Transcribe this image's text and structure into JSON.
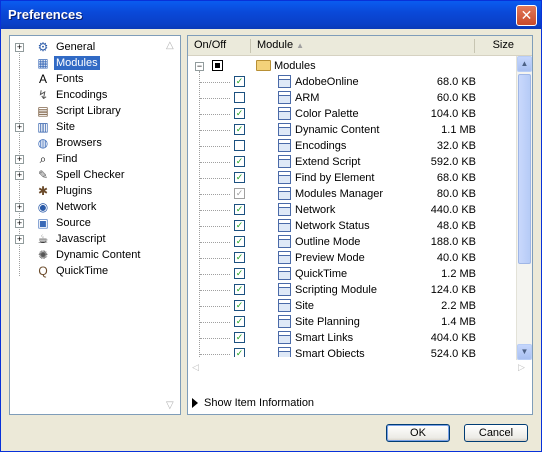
{
  "window": {
    "title": "Preferences",
    "close_glyph": "✕"
  },
  "sidebar": {
    "items": [
      {
        "label": "General",
        "icon": "gear-icon",
        "glyph": "⚙",
        "expander": "+"
      },
      {
        "label": "Modules",
        "icon": "module-icon",
        "glyph": "▦",
        "selected": true
      },
      {
        "label": "Fonts",
        "icon": "fonts-icon",
        "glyph": "A"
      },
      {
        "label": "Encodings",
        "icon": "encodings-icon",
        "glyph": "↯"
      },
      {
        "label": "Script Library",
        "icon": "script-library-icon",
        "glyph": "▤"
      },
      {
        "label": "Site",
        "icon": "site-icon",
        "glyph": "▥",
        "expander": "+"
      },
      {
        "label": "Browsers",
        "icon": "browsers-icon",
        "glyph": "◍"
      },
      {
        "label": "Find",
        "icon": "find-icon",
        "glyph": "⌕",
        "expander": "+"
      },
      {
        "label": "Spell Checker",
        "icon": "spell-checker-icon",
        "glyph": "✎",
        "expander": "+"
      },
      {
        "label": "Plugins",
        "icon": "plugins-icon",
        "glyph": "✱"
      },
      {
        "label": "Network",
        "icon": "network-icon",
        "glyph": "◉",
        "expander": "+"
      },
      {
        "label": "Source",
        "icon": "source-icon",
        "glyph": "▣",
        "expander": "+"
      },
      {
        "label": "Javascript",
        "icon": "javascript-icon",
        "glyph": "☕",
        "expander": "+"
      },
      {
        "label": "Dynamic Content",
        "icon": "dynamic-content-icon",
        "glyph": "✺"
      },
      {
        "label": "QuickTime",
        "icon": "quicktime-icon",
        "glyph": "Q"
      }
    ]
  },
  "modules_table": {
    "columns": {
      "onoff": "On/Off",
      "module": "Module",
      "size": "Size"
    },
    "sort_arrow": "▲",
    "folder": {
      "label": "Modules",
      "expander": "−"
    },
    "rows": [
      {
        "name": "AdobeOnline",
        "size": "68.0 KB",
        "checked": true
      },
      {
        "name": "ARM",
        "size": "60.0 KB",
        "checked": false
      },
      {
        "name": "Color Palette",
        "size": "104.0 KB",
        "checked": true
      },
      {
        "name": "Dynamic Content",
        "size": "1.1 MB",
        "checked": true
      },
      {
        "name": "Encodings",
        "size": "32.0 KB",
        "checked": false
      },
      {
        "name": "Extend Script",
        "size": "592.0 KB",
        "checked": true
      },
      {
        "name": "Find by Element",
        "size": "68.0 KB",
        "checked": true
      },
      {
        "name": "Modules Manager",
        "size": "80.0 KB",
        "checked": true,
        "disabled": true
      },
      {
        "name": "Network",
        "size": "440.0 KB",
        "checked": true
      },
      {
        "name": "Network Status",
        "size": "48.0 KB",
        "checked": true
      },
      {
        "name": "Outline Mode",
        "size": "188.0 KB",
        "checked": true
      },
      {
        "name": "Preview Mode",
        "size": "40.0 KB",
        "checked": true
      },
      {
        "name": "QuickTime",
        "size": "1.2 MB",
        "checked": true
      },
      {
        "name": "Scripting Module",
        "size": "124.0 KB",
        "checked": true
      },
      {
        "name": "Site",
        "size": "2.2 MB",
        "checked": true
      },
      {
        "name": "Site Planning",
        "size": "1.4 MB",
        "checked": true
      },
      {
        "name": "Smart Links",
        "size": "404.0 KB",
        "checked": true
      },
      {
        "name": "Smart Objects",
        "size": "524.0 KB",
        "checked": true
      }
    ]
  },
  "show_item_info": "Show Item Information",
  "buttons": {
    "ok": "OK",
    "cancel": "Cancel"
  },
  "colors": {
    "titlebar": "#0a49d9",
    "selection": "#316ac5",
    "check": "#21a121"
  }
}
